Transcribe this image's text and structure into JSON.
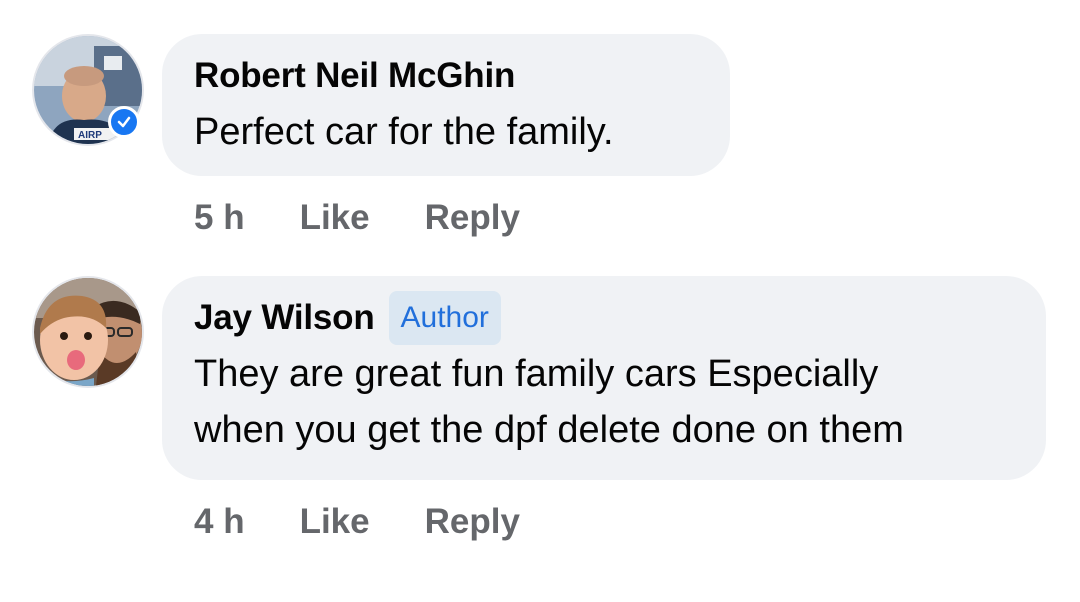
{
  "comments": [
    {
      "author": "Robert Neil McGhin",
      "badge": "",
      "text": "Perfect car for the family.",
      "time": "5 h",
      "like_label": "Like",
      "reply_label": "Reply",
      "verified": true
    },
    {
      "author": "Jay Wilson",
      "badge": "Author",
      "text": "They are great fun family cars Especially\nwhen you get the dpf delete done on them",
      "time": "4 h",
      "like_label": "Like",
      "reply_label": "Reply",
      "verified": false
    }
  ],
  "colors": {
    "bubble_bg": "#f0f2f5",
    "badge_bg": "#dbe7f2",
    "badge_text": "#216fdb",
    "meta_text": "#65676b",
    "verified_blue": "#1877f2"
  }
}
